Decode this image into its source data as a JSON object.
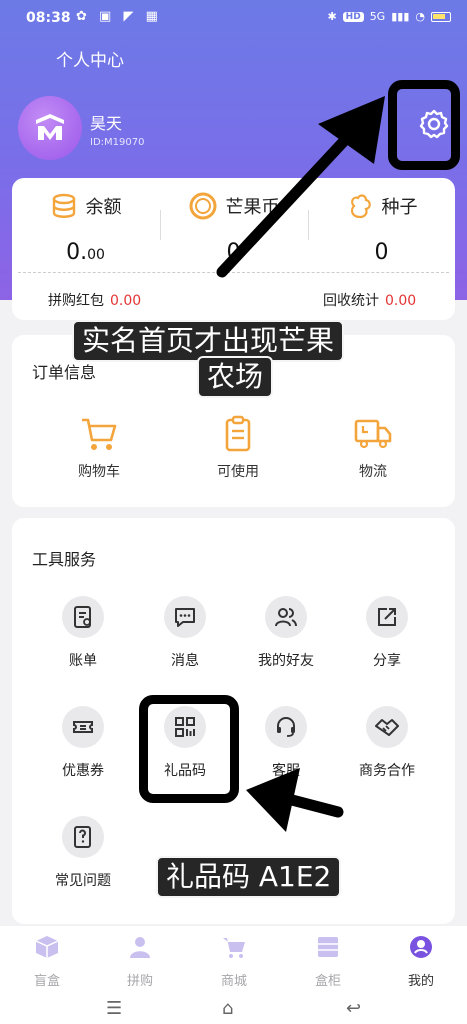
{
  "status": {
    "time": "08:38",
    "left_icons": "✿ ▣ ◤ ▦",
    "network_badge": "HD",
    "network_type": "5G"
  },
  "header": {
    "title": "个人中心"
  },
  "user": {
    "name": "昊天",
    "id": "ID:M19070"
  },
  "balance": {
    "items": [
      {
        "label": "余额",
        "value_int": "0.",
        "value_dec": "00",
        "icon": "coins-icon"
      },
      {
        "label": "芒果币",
        "value_int": "0",
        "value_dec": "",
        "icon": "coin-ring-icon"
      },
      {
        "label": "种子",
        "value_int": "0",
        "value_dec": "",
        "icon": "seed-icon"
      }
    ],
    "hongbao_label": "拼购红包",
    "hongbao_value": "0.00",
    "recycle_label": "回收统计",
    "recycle_value": "0.00"
  },
  "orders": {
    "title": "订单信息",
    "items": [
      {
        "label": "购物车",
        "icon": "cart-icon"
      },
      {
        "label": "可使用",
        "icon": "clipboard-icon"
      },
      {
        "label": "物流",
        "icon": "truck-icon"
      }
    ]
  },
  "tools": {
    "title": "工具服务",
    "items": [
      {
        "label": "账单",
        "icon": "bill-icon"
      },
      {
        "label": "消息",
        "icon": "message-icon"
      },
      {
        "label": "我的好友",
        "icon": "friends-icon"
      },
      {
        "label": "分享",
        "icon": "share-icon"
      },
      {
        "label": "优惠券",
        "icon": "coupon-icon"
      },
      {
        "label": "礼品码",
        "icon": "qrcode-icon"
      },
      {
        "label": "客服",
        "icon": "headset-icon"
      },
      {
        "label": "商务合作",
        "icon": "handshake-icon"
      },
      {
        "label": "常见问题",
        "icon": "faq-icon"
      }
    ]
  },
  "annotations": {
    "banner1_line1": "实名首页才出现芒果",
    "banner1_line2": "农场",
    "banner2": "礼品码 A1E2"
  },
  "nav": {
    "items": [
      {
        "label": "盲盒",
        "icon": "box-icon"
      },
      {
        "label": "拼购",
        "icon": "group-icon"
      },
      {
        "label": "商城",
        "icon": "mall-cart-icon"
      },
      {
        "label": "盒柜",
        "icon": "cabinet-icon"
      },
      {
        "label": "我的",
        "icon": "me-icon"
      }
    ],
    "active_index": 4
  },
  "colors": {
    "accent": "#7a6ee8",
    "orange": "#f3a53c",
    "red": "#e43535"
  }
}
